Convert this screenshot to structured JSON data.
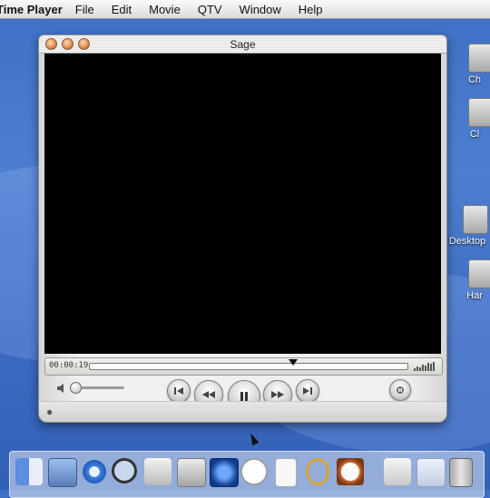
{
  "menubar": {
    "app_name": "Time Player",
    "items": [
      "File",
      "Edit",
      "Movie",
      "QTV",
      "Window",
      "Help"
    ]
  },
  "desktop": {
    "icons": [
      {
        "label": "Ch",
        "icon": "hard-drive-icon"
      },
      {
        "label": "Cl",
        "icon": "hard-drive-icon"
      },
      {
        "label": "Desktop",
        "icon": "folder-icon"
      },
      {
        "label": "Har",
        "icon": "hard-drive-icon"
      }
    ]
  },
  "window": {
    "title": "Sage",
    "timecode": "00:00:19",
    "playhead_position_fraction": 0.64,
    "volume_fraction": 0.0
  },
  "dock": {
    "items": [
      "finder-icon",
      "photo-icon",
      "internet-explorer-icon",
      "sherlock-icon",
      "apple-icon",
      "monitor-icon",
      "quicktime-icon",
      "clock-icon",
      "document-icon",
      "sherlock-ring-icon",
      "timer-icon",
      "mail-icon",
      "folder-icon",
      "trash-icon"
    ]
  },
  "colors": {
    "desktop_blue": "#3f6fc4",
    "video_bg": "#000000"
  }
}
